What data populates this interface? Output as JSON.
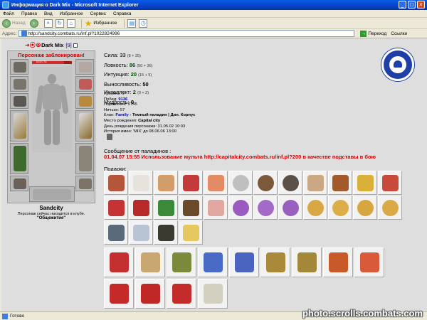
{
  "window": {
    "title": "Информация о Dark Mix - Microsoft Internet Explorer"
  },
  "menu": [
    "Файл",
    "Правка",
    "Вид",
    "Избранное",
    "Сервис",
    "Справка"
  ],
  "toolbar": {
    "back": "Назад",
    "favorites": "Избранное"
  },
  "address": {
    "label": "Адрес:",
    "url": "http://sandcity.combats.ru/inf.pl?1022824996",
    "go": "Переход",
    "links": "Ссылки"
  },
  "character": {
    "name": "Dark Mix",
    "level": "[9]",
    "locked": "Персонаж заблокирован!",
    "hp": "633/778",
    "city": "Sandcity",
    "location": "Персонаж сейчас находится в клубе.",
    "room": "\"Общежитие\""
  },
  "stats": [
    {
      "label": "Сила:",
      "value": "33",
      "bonus": "(8 + 25)"
    },
    {
      "label": "Ловкость:",
      "value": "86",
      "bonus": "(50 + 36)"
    },
    {
      "label": "Интуиция:",
      "value": "20",
      "bonus": "(15 + 5)"
    },
    {
      "label": "Выносливость:",
      "value": "50",
      "bonus": ""
    },
    {
      "label": "Интеллект:",
      "value": "2",
      "bonus": "(0 + 2)"
    },
    {
      "label": "Мудрость:",
      "value": "0",
      "bonus": ""
    }
  ],
  "details": {
    "level_label": "Уровень:",
    "level": "9",
    "wins_label": "Побед:",
    "wins": "9136",
    "losses_label": "Поражений:",
    "losses": "2745",
    "draws_label": "Ничьих:",
    "draws": "57",
    "clan_label": "Клан:",
    "clan": "Family",
    "clan_rank": "- Темный паладин | Дип. Корпус",
    "birthplace_label": "Место рождения:",
    "birthplace": "Capital city",
    "birthday": "День рождения персонажа: 31.05.02 10:03",
    "history": "История имен: 'MIX' до 08.06.06 13:00"
  },
  "message": {
    "label": "Сообщение от паладинов :",
    "text": "01.04.07 15:55 Использование мульта http://capitalcity.combats.ru/inf.pl?200 в качестве подставы в бою"
  },
  "gifts_label": "Подарки:",
  "colors": {
    "locked": "#cc0000",
    "stat_value": "#005500",
    "emblem": "#1f3ea8",
    "message": "#d40000"
  },
  "status": {
    "text": "Готово"
  },
  "watermark": "photo.scrolls.combats.com"
}
